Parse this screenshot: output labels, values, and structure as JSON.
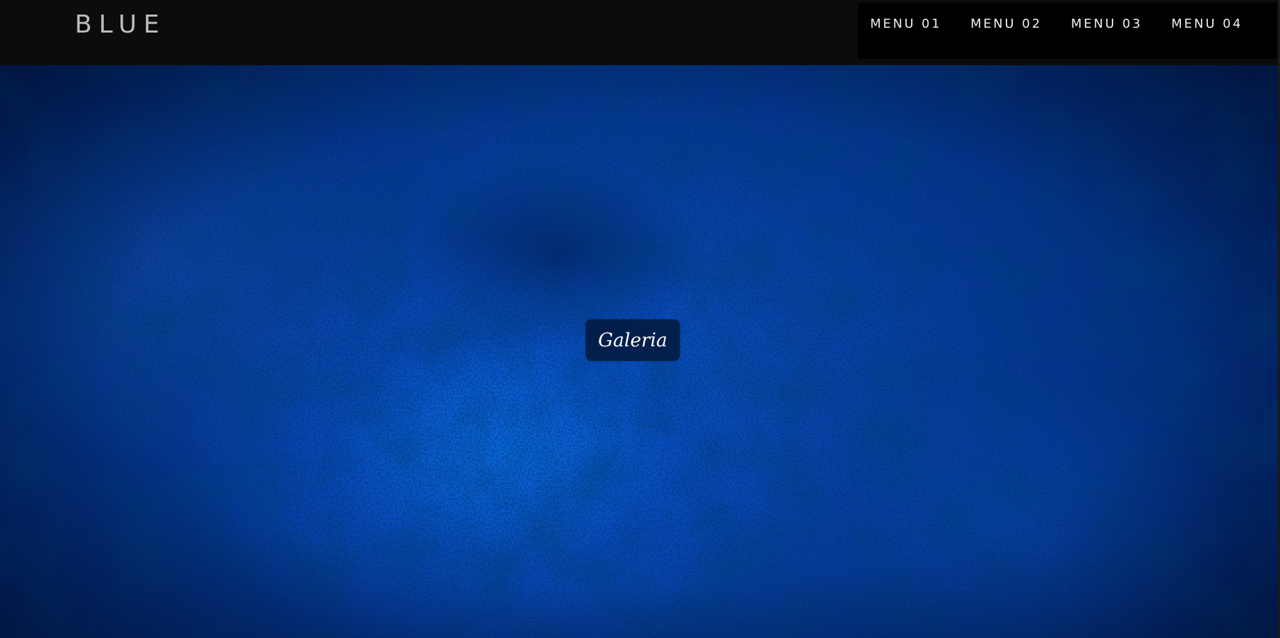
{
  "header": {
    "logo": "BLUE",
    "nav": [
      {
        "label": "MENU 01"
      },
      {
        "label": "MENU 02"
      },
      {
        "label": "MENU 03"
      },
      {
        "label": "MENU 04"
      }
    ]
  },
  "hero": {
    "button_label": "Galeria"
  },
  "colors": {
    "header_bg": "#0c0c0c",
    "nav_bg": "#000000",
    "hero_blue": "#0a4fc0",
    "button_bg": "#02193c"
  }
}
